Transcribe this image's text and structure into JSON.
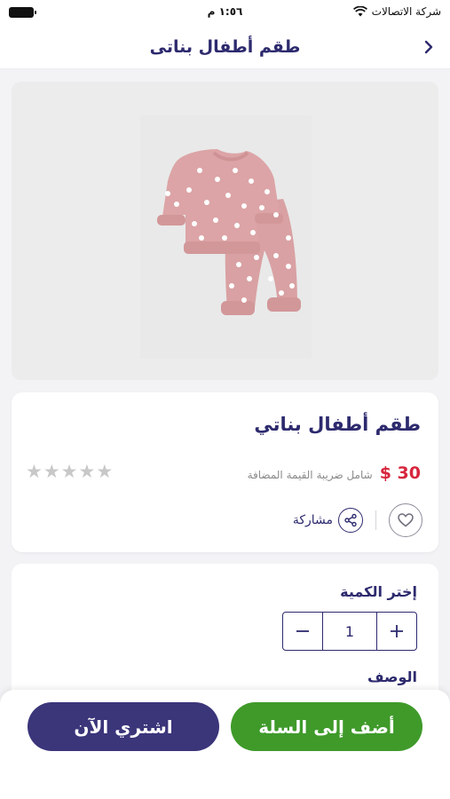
{
  "status_bar": {
    "carrier": "شركة الاتصالات",
    "time": "١:٥٦ م"
  },
  "header": {
    "title": "طقم أطفال بناتى"
  },
  "product": {
    "name": "طقم أطفال بناتي",
    "price": "30 $",
    "vat_note": "شامل ضريبة القيمة المضافة",
    "rating": 0,
    "rating_max": 5,
    "share_label": "مشاركة",
    "image_colors": {
      "background": "#ececec",
      "garment": "#d9a1a3",
      "dots": "#ffffff"
    }
  },
  "quantity": {
    "label": "إختر الكمية",
    "value": "1"
  },
  "description": {
    "label": "الوصف"
  },
  "actions": {
    "add_to_cart": "أضف إلى السلة",
    "buy_now": "اشتري الآن"
  },
  "colors": {
    "primary": "#2d2a6e",
    "price": "#d7263d",
    "cart_button": "#3f9a2a",
    "buy_button": "#3b357a"
  }
}
